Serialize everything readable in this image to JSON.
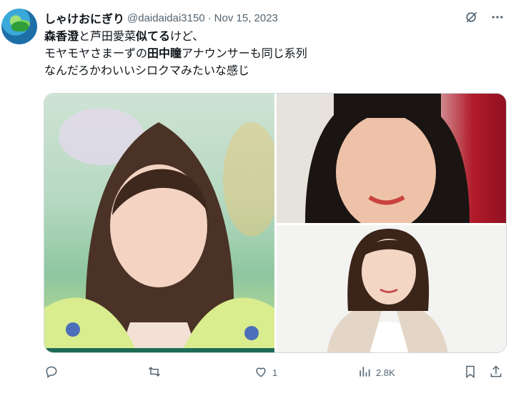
{
  "post": {
    "author_name": "しゃけおにぎり",
    "author_handle": "@daidaidai3150",
    "separator": "·",
    "date": "Nov 15, 2023",
    "text": {
      "line1": [
        {
          "t": "森香澄",
          "bold": true
        },
        {
          "t": "と芦田愛菜",
          "bold": false
        },
        {
          "t": "似てる",
          "bold": true
        },
        {
          "t": "けど、",
          "bold": false
        }
      ],
      "line2": [
        {
          "t": "モヤモヤさまーずの",
          "bold": false
        },
        {
          "t": "田中瞳",
          "bold": true
        },
        {
          "t": "アナウンサーも同じ系列",
          "bold": false
        }
      ],
      "line3": [
        {
          "t": "なんだろかわいいシロクマみたいな感じ",
          "bold": false
        }
      ]
    }
  },
  "media": {
    "images": [
      {
        "id": "main",
        "alt_hint": "photo-woman-long-hair-floral"
      },
      {
        "id": "top-right",
        "alt_hint": "photo-woman-bangs-red-backdrop"
      },
      {
        "id": "bottom-right",
        "alt_hint": "photo-woman-announcer-blazer"
      }
    ]
  },
  "actions": {
    "reply": {
      "icon": "reply-icon",
      "count": ""
    },
    "repost": {
      "icon": "repost-icon",
      "count": ""
    },
    "like": {
      "icon": "heart-icon",
      "count": "1"
    },
    "views": {
      "icon": "views-icon",
      "count": "2.8K"
    },
    "bookmark": {
      "icon": "bookmark-icon"
    },
    "share": {
      "icon": "share-icon"
    }
  },
  "top_icons": [
    "grok-slash-icon",
    "more-icon"
  ],
  "colors": {
    "text": "#0f1419",
    "muted": "#536471",
    "border": "#cfd9de"
  }
}
